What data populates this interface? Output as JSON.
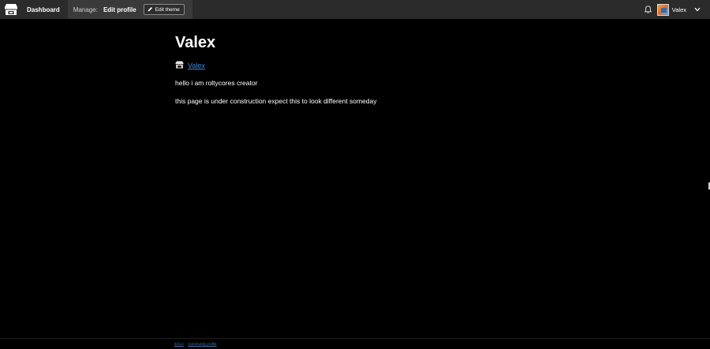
{
  "header": {
    "dashboard_label": "Dashboard",
    "manage_label": "Manage:",
    "manage_current": "Edit profile",
    "edit_theme_label": "Edit theme",
    "user_name": "Valex"
  },
  "profile": {
    "title": "Valex",
    "link_text": "Valex",
    "bio": [
      "hello i am roltycores creator",
      "this page is under construction expect this to look different someday"
    ]
  },
  "footer": {
    "links": [
      "itch.io",
      "Community profile"
    ]
  },
  "colors": {
    "background": "#000000",
    "header_bg": "#2b2b2b",
    "manage_bg": "#3a3a3a",
    "link": "#3c8bd8"
  },
  "icons": {
    "logo": "itchio-logo-icon",
    "edit": "pencil-icon",
    "notifications": "bell-icon",
    "menu": "chevron-down-icon",
    "profile_link": "itchio-store-icon"
  }
}
